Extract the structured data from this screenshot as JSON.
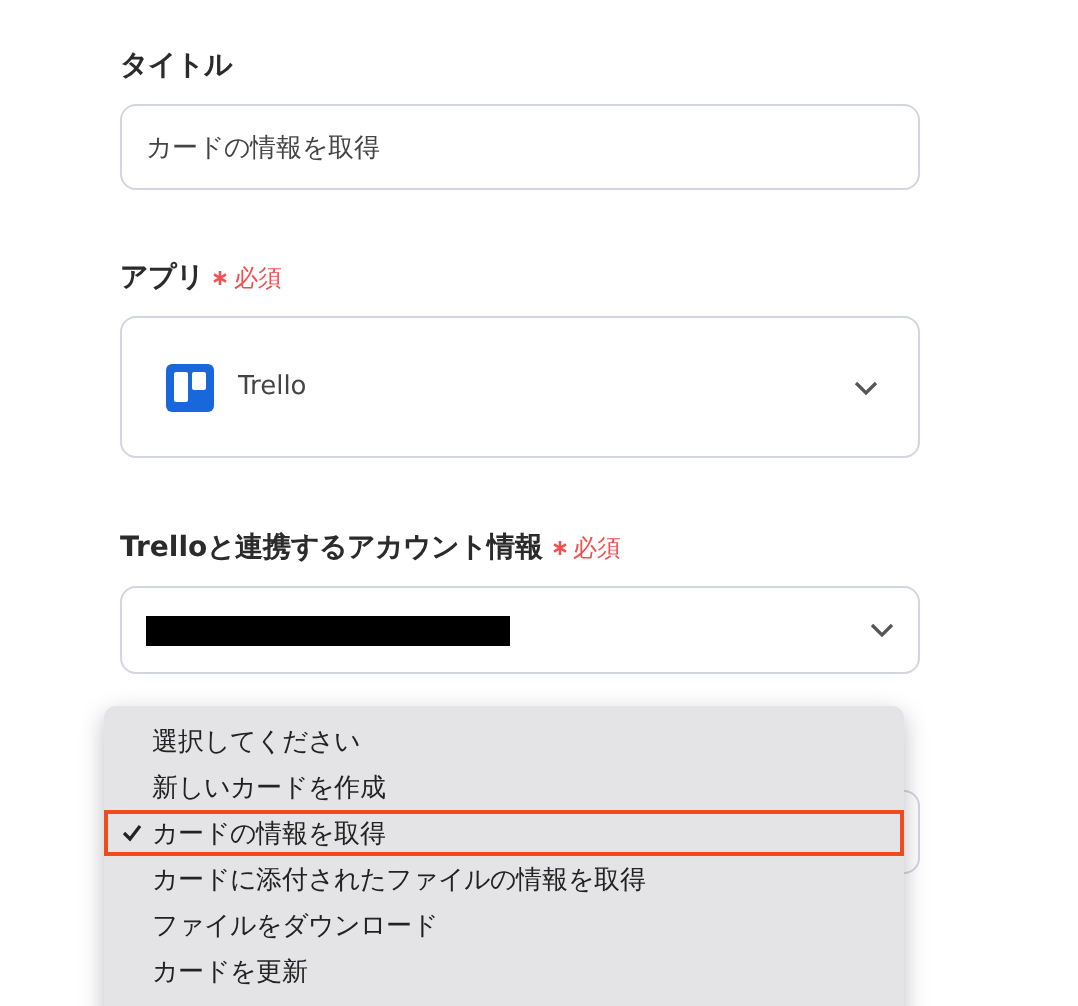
{
  "fields": [
    {
      "kind": "text",
      "label": "タイトル",
      "required": false,
      "value": "カードの情報を取得"
    },
    {
      "kind": "app",
      "label": "アプリ",
      "required": true,
      "required_text": "必須",
      "value": "Trello"
    },
    {
      "kind": "redacted",
      "label": "Trelloと連携するアカウント情報",
      "required": true,
      "required_text": "必須"
    }
  ],
  "menu": {
    "items": [
      {
        "label": "選択してください",
        "selected": false
      },
      {
        "label": "新しいカードを作成",
        "selected": false
      },
      {
        "label": "カードの情報を取得",
        "selected": true
      },
      {
        "label": "カードに添付されたファイルの情報を取得",
        "selected": false
      },
      {
        "label": "ファイルをダウンロード",
        "selected": false
      },
      {
        "label": "カードを更新",
        "selected": false
      }
    ]
  }
}
